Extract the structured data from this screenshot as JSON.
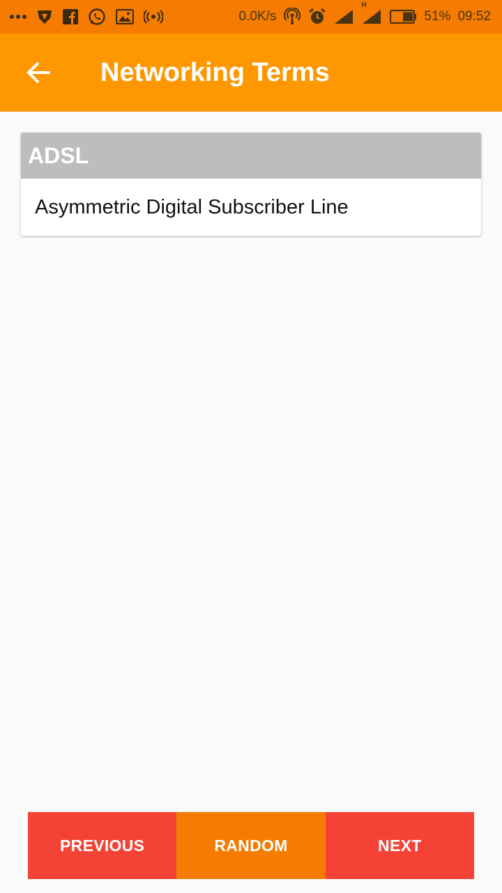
{
  "status_bar": {
    "net_speed": "0.0K/s",
    "battery_percent": "51%",
    "time": "09:52",
    "network_type": "H",
    "icons": [
      "more-icon",
      "shield-icon",
      "facebook-icon",
      "whatsapp-icon",
      "gallery-icon",
      "hotspot-icon",
      "wifi-hotspot-icon",
      "alarm-icon",
      "signal-icon",
      "battery-icon"
    ]
  },
  "app_bar": {
    "title": "Networking Terms",
    "back_icon": "arrow-back-icon"
  },
  "term": {
    "acronym": "ADSL",
    "definition": "Asymmetric Digital Subscriber Line"
  },
  "navigation": {
    "previous_label": "PREVIOUS",
    "random_label": "RANDOM",
    "next_label": "NEXT"
  },
  "colors": {
    "status_bar": "#f57c00",
    "app_bar": "#ff9800",
    "card_header": "#bdbdbd",
    "button_red": "#f44336",
    "button_orange": "#f57c00"
  }
}
